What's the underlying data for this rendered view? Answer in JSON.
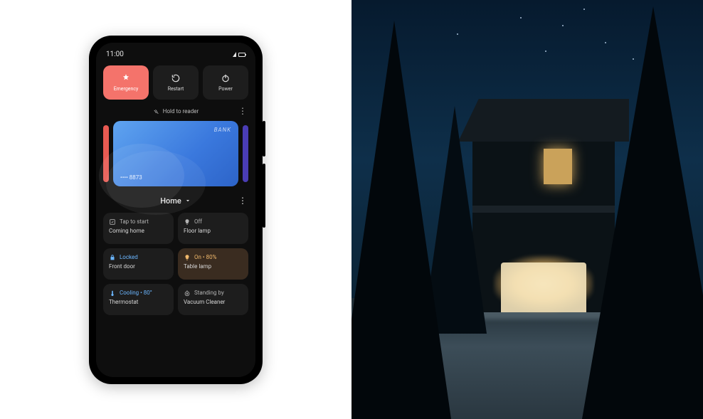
{
  "status": {
    "time": "11:00"
  },
  "power": {
    "emergency": "Emergency",
    "restart": "Restart",
    "power": "Power"
  },
  "wallet": {
    "hint": "Hold to reader",
    "card": {
      "brand": "BANK",
      "last_digits": "•••• 8873"
    }
  },
  "home": {
    "title": "Home",
    "tiles": [
      {
        "status": "Tap to start",
        "name": "Coming home",
        "tone": "grey",
        "icon": "routine"
      },
      {
        "status": "Off",
        "name": "Floor lamp",
        "tone": "grey",
        "icon": "bulb"
      },
      {
        "status": "Locked",
        "name": "Front door",
        "tone": "blue",
        "icon": "lock"
      },
      {
        "status": "On • 80%",
        "name": "Table lamp",
        "tone": "amber",
        "icon": "bulb",
        "warm": true
      },
      {
        "status": "Cooling • 80°",
        "name": "Thermostat",
        "tone": "blue",
        "icon": "thermo"
      },
      {
        "status": "Standing by",
        "name": "Vacuum Cleaner",
        "tone": "grey",
        "icon": "vacuum"
      }
    ]
  }
}
